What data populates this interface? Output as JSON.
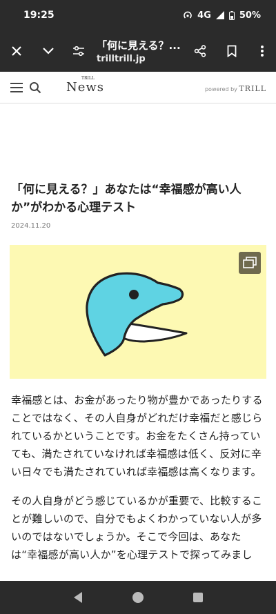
{
  "status": {
    "time": "19:25",
    "network": "4G",
    "battery": "50%"
  },
  "browser": {
    "title": "「何に見える？...",
    "domain": "trilltrill.jp"
  },
  "site": {
    "logo": "News",
    "logo_small": "TRILL",
    "powered_by": "powered by",
    "powered_brand": "TRILL"
  },
  "article": {
    "title": "「何に見える？」あなたは“幸福感が高い人か”がわかる心理テスト",
    "date": "2024.11.20",
    "paragraphs": [
      "幸福感とは、お金があったり物が豊かであったりすることではなく、その人自身がどれだけ幸福だと感じられているかということです。お金をたくさん持っていても、満たされていなければ幸福感は低く、反対に辛い日々でも満たされていれば幸福感は高くなります。",
      "その人自身がどう感じているかが重要で、比較することが難しいので、自分でもよくわかっていない人が多いのではないでしょうか。そこで今回は、あなたは“幸福感が高い人か”を心理テストで探ってみまし"
    ]
  },
  "colors": {
    "hero_bg": "#fdf9b3",
    "dolphin": "#5fd3e3",
    "chrome": "#2b2b2b"
  }
}
